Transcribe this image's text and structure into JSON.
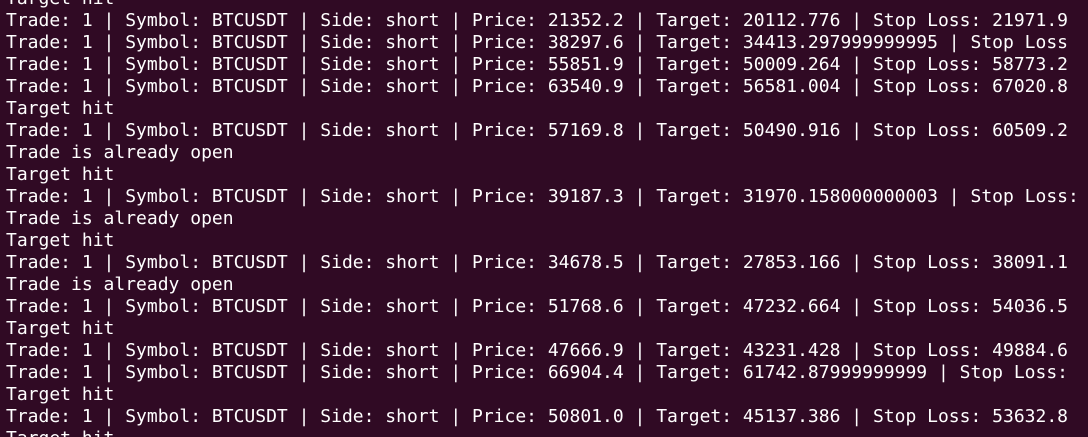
{
  "terminal": {
    "background": "#300a24",
    "foreground": "#ffffff",
    "lines": [
      "Target hit",
      "Trade: 1 | Symbol: BTCUSDT | Side: short | Price: 21352.2 | Target: 20112.776 | Stop Loss: 21971.9",
      "Trade: 1 | Symbol: BTCUSDT | Side: short | Price: 38297.6 | Target: 34413.297999999995 | Stop Loss",
      "Trade: 1 | Symbol: BTCUSDT | Side: short | Price: 55851.9 | Target: 50009.264 | Stop Loss: 58773.2",
      "Trade: 1 | Symbol: BTCUSDT | Side: short | Price: 63540.9 | Target: 56581.004 | Stop Loss: 67020.8",
      "Target hit",
      "Trade: 1 | Symbol: BTCUSDT | Side: short | Price: 57169.8 | Target: 50490.916 | Stop Loss: 60509.2",
      "Trade is already open",
      "Target hit",
      "Trade: 1 | Symbol: BTCUSDT | Side: short | Price: 39187.3 | Target: 31970.158000000003 | Stop Loss:",
      "Trade is already open",
      "Target hit",
      "Trade: 1 | Symbol: BTCUSDT | Side: short | Price: 34678.5 | Target: 27853.166 | Stop Loss: 38091.1",
      "Trade is already open",
      "Trade: 1 | Symbol: BTCUSDT | Side: short | Price: 51768.6 | Target: 47232.664 | Stop Loss: 54036.5",
      "Target hit",
      "Trade: 1 | Symbol: BTCUSDT | Side: short | Price: 47666.9 | Target: 43231.428 | Stop Loss: 49884.6",
      "Trade: 1 | Symbol: BTCUSDT | Side: short | Price: 66904.4 | Target: 61742.87999999999 | Stop Loss:",
      "Target hit",
      "Trade: 1 | Symbol: BTCUSDT | Side: short | Price: 50801.0 | Target: 45137.386 | Stop Loss: 53632.8",
      "Target hit"
    ]
  }
}
